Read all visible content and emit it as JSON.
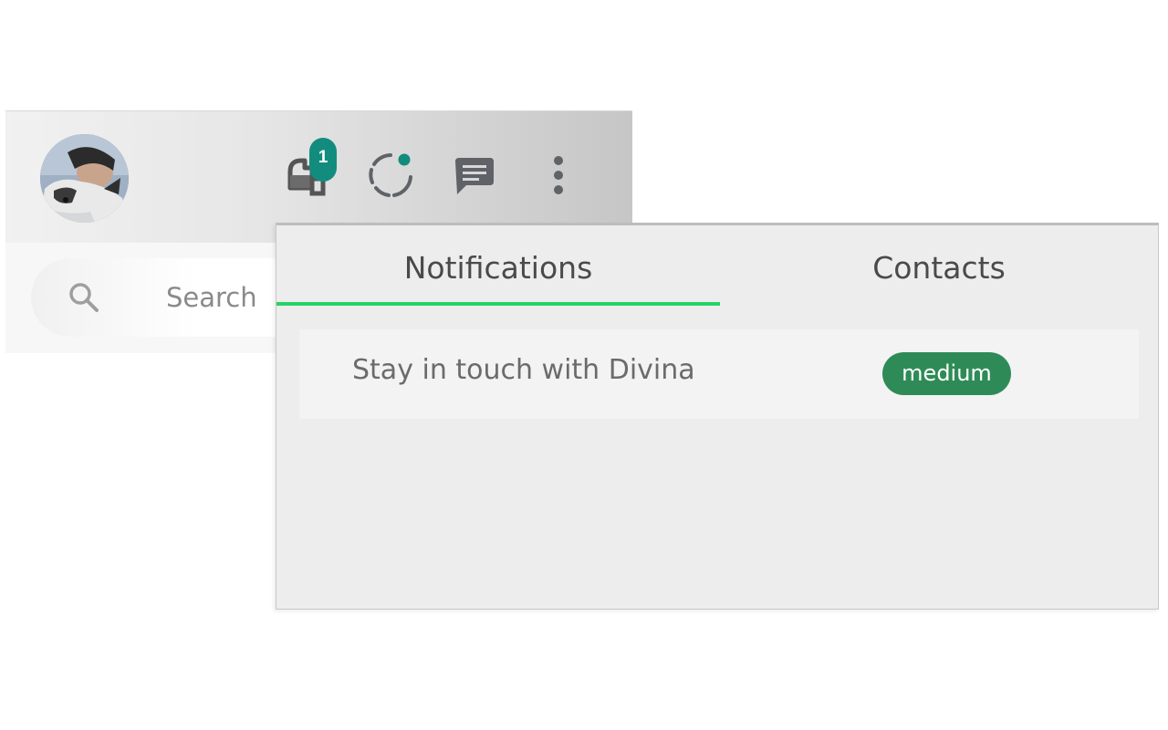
{
  "header": {
    "avatar_alt": "profile photo",
    "icons": {
      "extension": "extension-icon",
      "status": "status-icon",
      "chat": "chat-icon",
      "menu": "more-vertical-icon"
    },
    "notification_count": "1"
  },
  "search": {
    "placeholder": "Search",
    "icon": "search-icon"
  },
  "popup": {
    "tabs": [
      {
        "label": "Notifications",
        "active": true
      },
      {
        "label": "Contacts",
        "active": false
      }
    ],
    "notifications": [
      {
        "text": "Stay in touch with Divina",
        "priority": "medium"
      }
    ]
  },
  "colors": {
    "badge_teal": "#128c7e",
    "tab_underline": "#25d366",
    "priority_medium": "#2e8b57",
    "status_dot": "#128c7e"
  }
}
